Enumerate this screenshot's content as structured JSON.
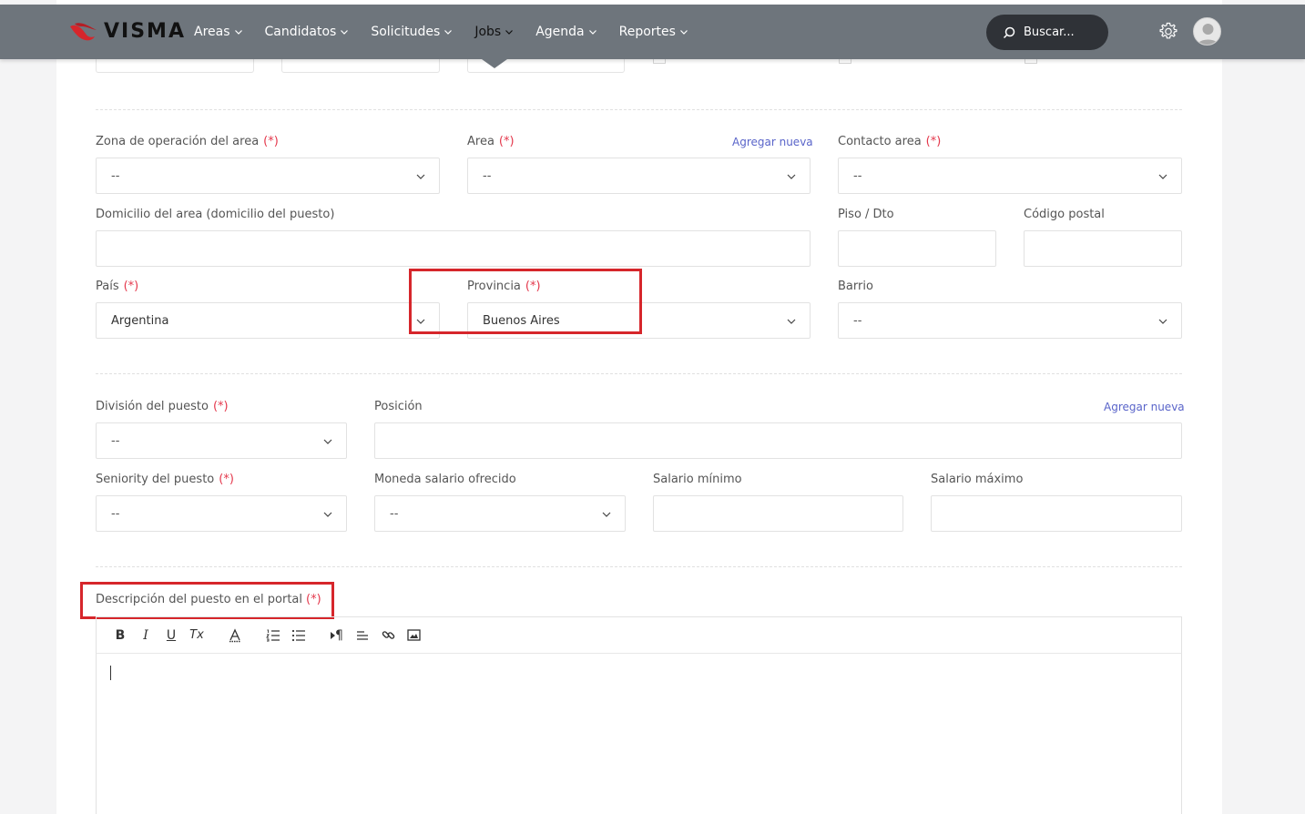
{
  "brand": {
    "name": "VISMA",
    "accent": "#d6262b"
  },
  "nav": {
    "items": [
      {
        "label": "Areas"
      },
      {
        "label": "Candidatos"
      },
      {
        "label": "Solicitudes"
      },
      {
        "label": "Jobs",
        "active": true
      },
      {
        "label": "Agenda"
      },
      {
        "label": "Reportes"
      }
    ],
    "search_label": "Buscar...",
    "icons": [
      "search-icon",
      "gear-icon",
      "avatar"
    ]
  },
  "section_area": {
    "zona": {
      "label": "Zona de operación del area",
      "required": "(*)",
      "value": "--"
    },
    "area": {
      "label": "Area",
      "required": "(*)",
      "value": "--",
      "add_link": "Agregar nueva"
    },
    "contacto": {
      "label": "Contacto area",
      "required": "(*)",
      "value": "--"
    },
    "domicilio": {
      "label": "Domicilio del area (domicilio del puesto)",
      "value": ""
    },
    "piso": {
      "label": "Piso / Dto",
      "value": ""
    },
    "codigo_postal": {
      "label": "Código postal",
      "value": ""
    },
    "pais": {
      "label": "País",
      "required": "(*)",
      "value": "Argentina"
    },
    "provincia": {
      "label": "Provincia",
      "required": "(*)",
      "value": "Buenos Aires"
    },
    "barrio": {
      "label": "Barrio",
      "value": "--"
    }
  },
  "section_puesto": {
    "division": {
      "label": "División del puesto",
      "required": "(*)",
      "value": "--"
    },
    "posicion": {
      "label": "Posición",
      "value": "",
      "add_link": "Agregar nueva"
    },
    "seniority": {
      "label": "Seniority del puesto",
      "required": "(*)",
      "value": "--"
    },
    "moneda": {
      "label": "Moneda salario ofrecido",
      "value": "--"
    },
    "salario_min": {
      "label": "Salario mínimo",
      "value": ""
    },
    "salario_max": {
      "label": "Salario máximo",
      "value": ""
    }
  },
  "section_descripcion": {
    "label": "Descripción del puesto en el portal",
    "required": "(*)",
    "toolbar": {
      "bold": "B",
      "italic": "I",
      "underline": "U",
      "clear_format": "Tx",
      "paragraph": "¶"
    }
  }
}
